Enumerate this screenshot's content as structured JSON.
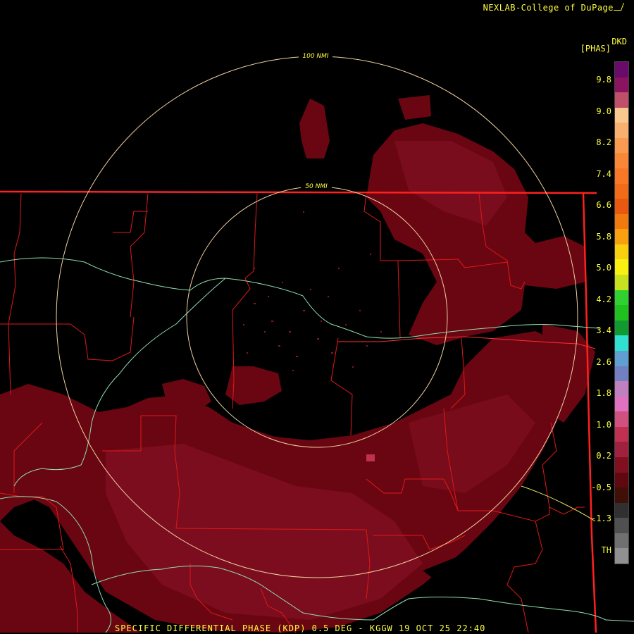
{
  "header": {
    "credit": "NEXLAB-College of DuPage"
  },
  "legend": {
    "product_code": "DKD",
    "units": "[PHAS]",
    "labels": [
      "9.8",
      "9.0",
      "8.2",
      "7.4",
      "6.6",
      "5.8",
      "5.0",
      "4.2",
      "3.4",
      "2.6",
      "1.8",
      "1.0",
      "0.2",
      "-0.5",
      "-1.3",
      "TH"
    ],
    "colors": [
      "#6a0a6a",
      "#8a1460",
      "#c0506a",
      "#f8c890",
      "#f8b070",
      "#f89a50",
      "#f88838",
      "#f87828",
      "#f06c18",
      "#e85810",
      "#f07a10",
      "#f8a010",
      "#f8d010",
      "#f8f010",
      "#c8e020",
      "#30d030",
      "#20c020",
      "#109a30",
      "#30e0d0",
      "#60a0d0",
      "#7080c0",
      "#c080c0",
      "#e070c0",
      "#d05080",
      "#c03050",
      "#a02040",
      "#801020",
      "#600810",
      "#401008",
      "#303030",
      "#505050",
      "#707070",
      "#909090"
    ]
  },
  "range_rings": [
    {
      "label": "100 NMI"
    },
    {
      "label": "50 NMI"
    }
  ],
  "footer": {
    "caption": "SPECIFIC DIFFERENTIAL PHASE (KDP) 0.5 DEG - KGGW 19 OCT 25 22:40"
  },
  "colors": {
    "echo": "#6a0612",
    "echo_light": "#8a1428",
    "county_line": "#e01818",
    "border_line": "#ff2020",
    "river": "#90e0b0",
    "road": "#e0e060",
    "ring": "#f0d0a0",
    "text": "#ffff40"
  }
}
